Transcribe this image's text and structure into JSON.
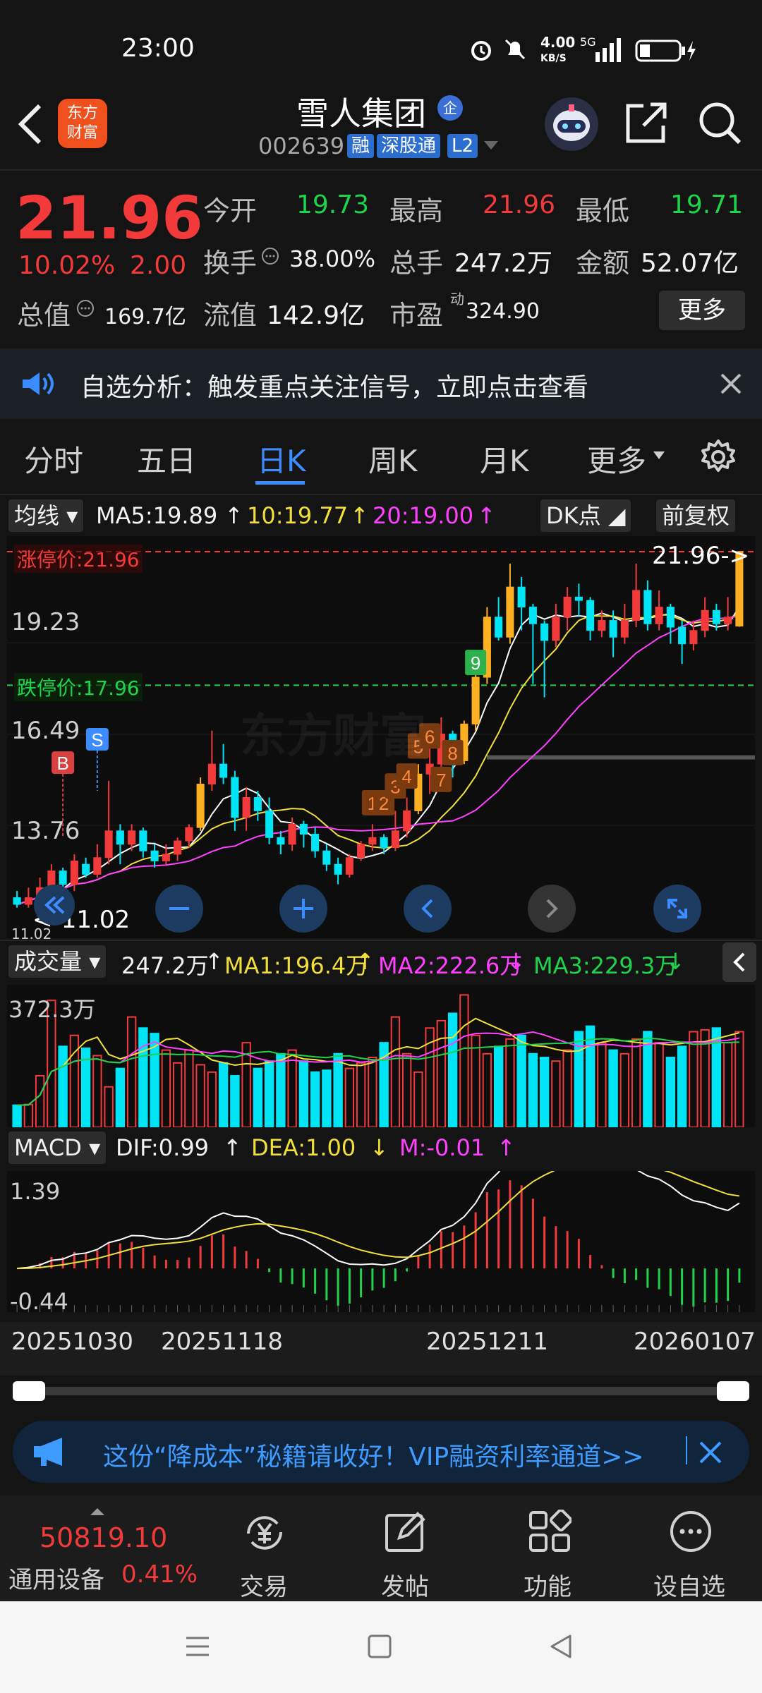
{
  "status_bar": {
    "time": "23:00",
    "network_speed": "4.00",
    "speed_unit": "KB/S",
    "signal": "5G"
  },
  "header": {
    "back_icon": "chevron-left-icon",
    "logo_text_1": "东方",
    "logo_text_2": "财富",
    "stock_name": "雪人集团",
    "qi_badge": "企",
    "stock_code": "002639",
    "tags": [
      "融",
      "深股通",
      "L2"
    ],
    "icons": [
      "robot-avatar-icon",
      "share-icon",
      "search-icon"
    ]
  },
  "quote": {
    "price": "21.96",
    "change_pct": "10.02%",
    "change": "2.00",
    "open_label": "今开",
    "open": "19.73",
    "high_label": "最高",
    "high": "21.96",
    "low_label": "最低",
    "low": "19.71",
    "turnover_label": "换手",
    "turnover": "38.00%",
    "volume_label": "总手",
    "volume": "247.2万",
    "amount_label": "金额",
    "amount": "52.07亿",
    "mcap_label": "总值",
    "mcap": "169.7亿",
    "float_label": "流值",
    "float": "142.9亿",
    "pe_label": "市盈",
    "pe_sup": "动",
    "pe": "324.90",
    "more_button": "更多"
  },
  "notice": {
    "text": "自选分析：触发重点关注信号，立即点击查看"
  },
  "tabs": [
    {
      "label": "分时"
    },
    {
      "label": "五日"
    },
    {
      "label": "日K",
      "active": true
    },
    {
      "label": "周K"
    },
    {
      "label": "月K"
    },
    {
      "label": "更多"
    }
  ],
  "kline": {
    "indicator": "均线",
    "ma5": "MA5:19.89",
    "ma10": "10:19.77",
    "ma20": "20:19.00",
    "dk_button": "DK点",
    "adjust_button": "前复权",
    "limit_up": "涨停价:21.96",
    "limit_down": "跌停价:17.96",
    "top_axis": "21.96",
    "y_labels": [
      "19.23",
      "16.49",
      "13.76"
    ],
    "bottom_axis": "11.02",
    "last_price_label": "21.96->",
    "min_price_label": "<-11.02",
    "watermark": "东方财富",
    "markers": {
      "b": "B",
      "s": "S",
      "steps": [
        "1",
        "2",
        "3",
        "4",
        "5",
        "6",
        "7",
        "8",
        "9"
      ]
    },
    "candles": [
      [
        11.6,
        11.4,
        11.8,
        11.3
      ],
      [
        11.4,
        11.6,
        11.9,
        11.3
      ],
      [
        11.6,
        11.9,
        12.2,
        11.5
      ],
      [
        11.9,
        12.4,
        12.6,
        11.8
      ],
      [
        12.4,
        12.0,
        12.5,
        11.7
      ],
      [
        12.0,
        12.7,
        12.9,
        11.8
      ],
      [
        12.6,
        12.3,
        12.8,
        12.2
      ],
      [
        12.3,
        12.8,
        13.2,
        12.2
      ],
      [
        12.8,
        13.6,
        15.1,
        12.6
      ],
      [
        13.6,
        13.2,
        13.8,
        12.6
      ],
      [
        13.2,
        13.6,
        13.8,
        13.0
      ],
      [
        13.6,
        13.0,
        13.7,
        12.8
      ],
      [
        13.0,
        12.7,
        13.2,
        12.5
      ],
      [
        12.7,
        12.9,
        13.2,
        12.6
      ],
      [
        12.9,
        13.3,
        13.4,
        12.7
      ],
      [
        13.3,
        13.7,
        13.8,
        13.1
      ],
      [
        13.7,
        15.0,
        15.2,
        13.6
      ],
      [
        15.0,
        15.6,
        16.6,
        14.8
      ],
      [
        15.6,
        15.2,
        16.2,
        15.0
      ],
      [
        15.2,
        14.0,
        15.4,
        13.6
      ],
      [
        14.0,
        14.6,
        14.9,
        13.6
      ],
      [
        14.6,
        14.2,
        14.8,
        13.9
      ],
      [
        14.2,
        13.4,
        14.6,
        13.2
      ],
      [
        13.4,
        13.2,
        13.6,
        12.9
      ],
      [
        13.2,
        13.8,
        14.0,
        13.0
      ],
      [
        13.8,
        13.5,
        13.9,
        13.1
      ],
      [
        13.5,
        13.0,
        13.7,
        12.8
      ],
      [
        13.0,
        12.6,
        13.2,
        12.4
      ],
      [
        12.6,
        12.3,
        12.8,
        12.0
      ],
      [
        12.3,
        12.8,
        12.9,
        12.2
      ],
      [
        12.8,
        13.2,
        13.3,
        12.7
      ],
      [
        13.2,
        13.4,
        13.8,
        13.0
      ],
      [
        13.4,
        13.1,
        13.5,
        12.9
      ],
      [
        13.1,
        13.6,
        14.2,
        13.0
      ],
      [
        13.6,
        14.2,
        14.6,
        13.4
      ],
      [
        14.2,
        15.3,
        15.6,
        14.1
      ],
      [
        15.3,
        15.6,
        16.8,
        14.7
      ],
      [
        15.6,
        16.5,
        17.0,
        15.2
      ],
      [
        16.5,
        15.7,
        16.6,
        15.2
      ],
      [
        15.7,
        16.8,
        16.9,
        15.6
      ],
      [
        16.8,
        18.2,
        18.5,
        16.6
      ],
      [
        18.2,
        20.0,
        20.3,
        18.0
      ],
      [
        20.0,
        19.4,
        20.6,
        19.3
      ],
      [
        19.4,
        20.9,
        21.6,
        19.2
      ],
      [
        20.9,
        20.3,
        21.2,
        19.6
      ],
      [
        20.3,
        19.8,
        20.4,
        18.0
      ],
      [
        19.8,
        19.3,
        19.9,
        17.6
      ],
      [
        19.3,
        20.0,
        20.4,
        19.1
      ],
      [
        20.0,
        20.6,
        20.9,
        19.6
      ],
      [
        20.6,
        20.5,
        21.0,
        20.0
      ],
      [
        20.5,
        19.6,
        20.6,
        19.3
      ],
      [
        19.6,
        19.9,
        20.2,
        19.4
      ],
      [
        19.9,
        19.4,
        20.2,
        18.8
      ],
      [
        19.4,
        19.9,
        20.4,
        19.2
      ],
      [
        19.9,
        20.8,
        21.6,
        19.7
      ],
      [
        20.8,
        19.8,
        21.1,
        19.6
      ],
      [
        19.8,
        20.3,
        20.8,
        19.6
      ],
      [
        20.3,
        19.7,
        20.4,
        19.2
      ],
      [
        19.7,
        19.2,
        19.9,
        18.6
      ],
      [
        19.2,
        19.6,
        19.9,
        19.0
      ],
      [
        19.6,
        20.2,
        20.6,
        19.4
      ],
      [
        20.2,
        19.8,
        20.4,
        19.6
      ],
      [
        19.8,
        20.0,
        20.6,
        19.6
      ],
      [
        19.73,
        21.96,
        21.96,
        19.71
      ]
    ]
  },
  "volume": {
    "indicator": "成交量",
    "current": "247.2万",
    "ma1": "MA1:196.4万",
    "ma2": "MA2:222.6万",
    "ma3": "MA3:229.3万",
    "top_label": "372.3万",
    "values": [
      60,
      62,
      140,
      345,
      220,
      250,
      215,
      195,
      110,
      160,
      300,
      270,
      255,
      210,
      175,
      210,
      170,
      150,
      175,
      140,
      230,
      160,
      180,
      200,
      210,
      180,
      150,
      155,
      200,
      160,
      175,
      190,
      230,
      300,
      200,
      150,
      270,
      290,
      310,
      360,
      250,
      200,
      220,
      240,
      250,
      200,
      190,
      180,
      210,
      260,
      275,
      230,
      210,
      200,
      240,
      260,
      230,
      190,
      220,
      260,
      265,
      270,
      230,
      260
    ]
  },
  "macd": {
    "indicator": "MACD",
    "dif": "DIF:0.99",
    "dea": "DEA:1.00",
    "m": "M:-0.01",
    "top_label": "1.39",
    "bottom_label": "-0.44",
    "dates": [
      "20251030",
      "20251118",
      "20251211",
      "20260107"
    ]
  },
  "banner": {
    "text": "这份“降成本”秘籍请收好！VIP融资利率通道>>"
  },
  "bottom_nav": {
    "index_value": "50819.10",
    "index_name": "通用设备",
    "index_pct": "0.41%",
    "items": [
      {
        "label": "交易",
        "icon": "yen-cycle-icon"
      },
      {
        "label": "发帖",
        "icon": "edit-icon"
      },
      {
        "label": "功能",
        "icon": "grid-icon"
      },
      {
        "label": "设自选",
        "icon": "more-circle-icon"
      }
    ]
  }
}
